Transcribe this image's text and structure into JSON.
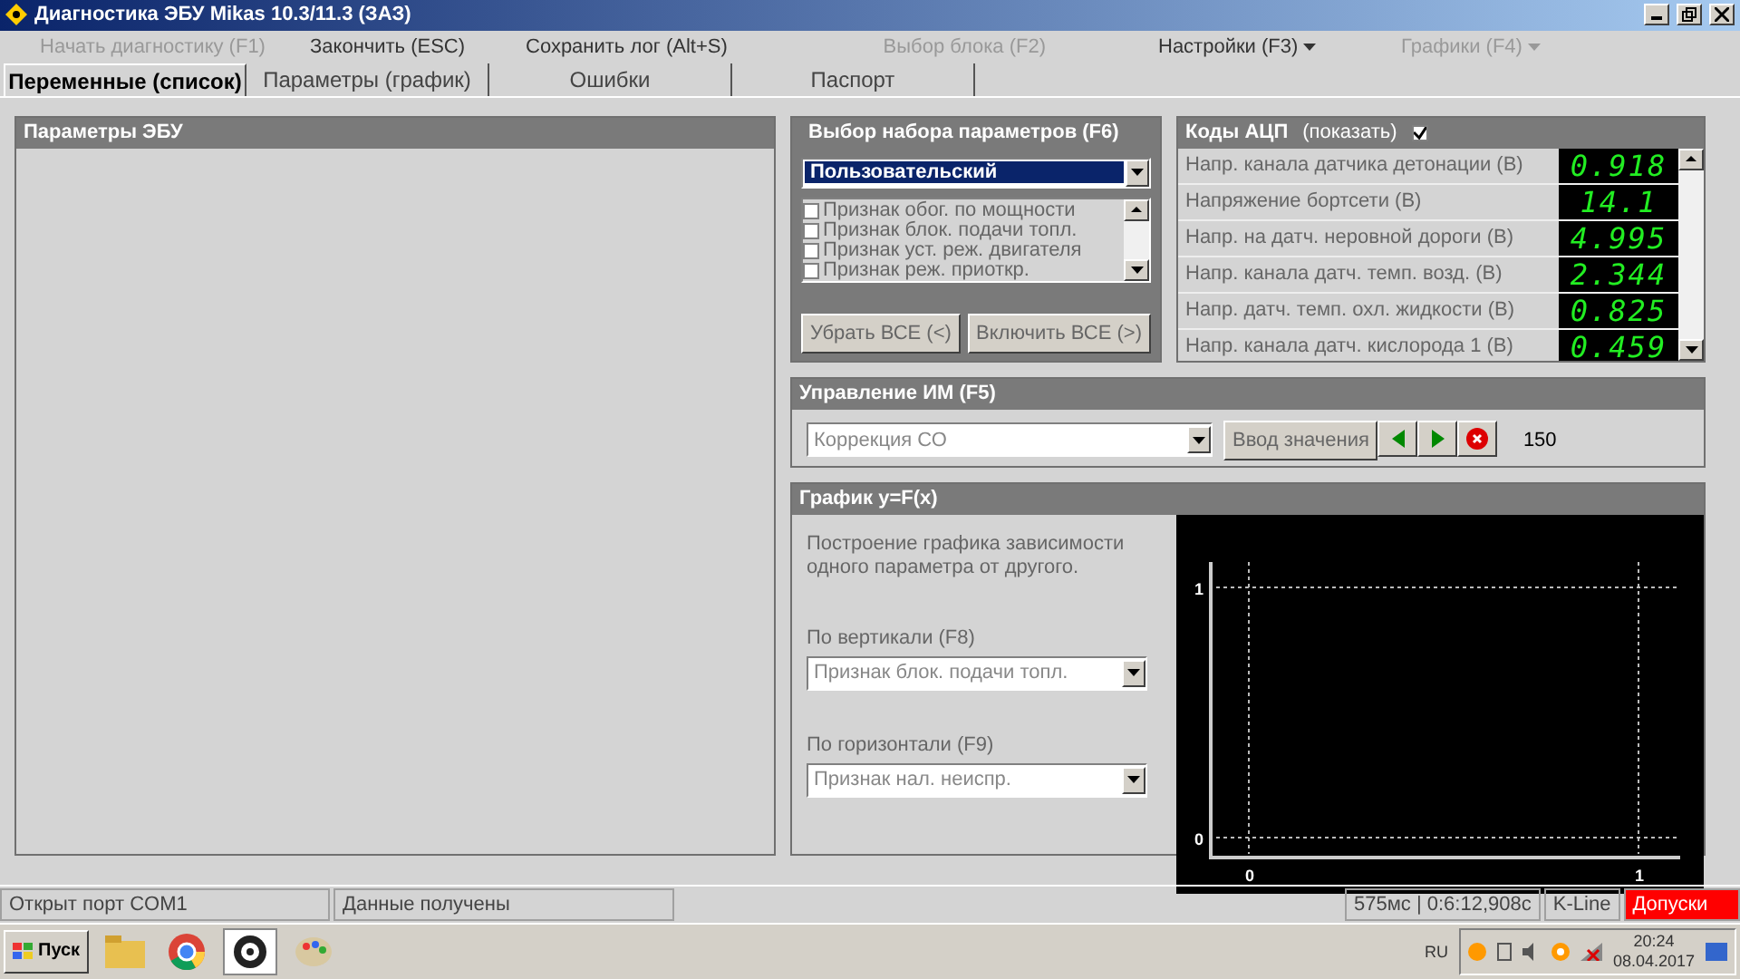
{
  "window": {
    "title": "Диагностика ЭБУ Mikas 10.3/11.3 (ЗАЗ)"
  },
  "menu": [
    {
      "label": "Начать диагностику (F1)",
      "disabled": true,
      "dropdown": false
    },
    {
      "label": "Закончить (ESC)",
      "disabled": false,
      "dropdown": false
    },
    {
      "label": "Сохранить лог (Alt+S)",
      "disabled": false,
      "dropdown": false
    },
    {
      "label": "Выбор блока (F2)",
      "disabled": true,
      "dropdown": false
    },
    {
      "label": "Настройки (F3)",
      "disabled": false,
      "dropdown": true
    },
    {
      "label": "Графики (F4)",
      "disabled": true,
      "dropdown": true
    }
  ],
  "tabs": [
    {
      "label": "Переменные (список)",
      "selected": true
    },
    {
      "label": "Параметры (график)",
      "selected": false
    },
    {
      "label": "Ошибки",
      "selected": false
    },
    {
      "label": "Паспорт",
      "selected": false
    }
  ],
  "ecu_panel": {
    "title": "Параметры ЭБУ"
  },
  "param_set": {
    "title": "Выбор набора параметров (F6)",
    "value": "Пользовательский",
    "items": [
      {
        "label": "Признак обог. по мощности",
        "checked": false
      },
      {
        "label": "Признак блок. подачи топл.",
        "checked": false
      },
      {
        "label": "Признак уст. реж. двигателя",
        "checked": false
      },
      {
        "label": "Признак реж. приоткр.",
        "checked": false
      }
    ],
    "buttons": [
      "Убрать ВСЕ (<)",
      "Включить ВСЕ (>)"
    ]
  },
  "adc": {
    "title": "Коды АЦП",
    "show_label": "(показать)",
    "show_checked": true,
    "rows": [
      {
        "name": "Напр. канала датчика детонации (В)",
        "value": "0.918"
      },
      {
        "name": "Напряжение бортсети (В)",
        "value": "14.1"
      },
      {
        "name": "Напр. на датч. неровной дороги (В)",
        "value": "4.995"
      },
      {
        "name": "Напр. канала датч. темп. возд. (В)",
        "value": "2.344"
      },
      {
        "name": "Напр. датч. темп. охл. жидкости (В)",
        "value": "0.825"
      },
      {
        "name": "Напр. канала датч. кислорода 1 (В)",
        "value": "0.459"
      }
    ]
  },
  "control": {
    "title": "Управление ИМ (F5)",
    "value": "Коррекция СО",
    "button": "Ввод значения",
    "reading": "150"
  },
  "graph": {
    "title": "График y=F(x)",
    "description": "Построение графика зависимости одного параметра от другого.",
    "vertical_label": "По вертикали (F8)",
    "vertical_value": "Признак блок. подачи топл.",
    "horizontal_label": "По горизонтали (F9)",
    "horizontal_value": "Признак нал. неиспр.",
    "chart_data": {
      "type": "line",
      "xlim": [
        0,
        1
      ],
      "ylim": [
        0,
        1
      ],
      "xticks": [
        0,
        1
      ],
      "yticks": [
        0,
        1
      ]
    }
  },
  "status_bar": [
    {
      "text": "Открыт порт COM1",
      "kind": "normal"
    },
    {
      "text": "Данные получены",
      "kind": "normal"
    },
    {
      "text": "575мс | 0:6:12,908с",
      "kind": "normal"
    },
    {
      "text": "K-Line",
      "kind": "normal"
    },
    {
      "text": "Допуски",
      "kind": "alert"
    }
  ],
  "taskbar": {
    "start": "Пуск",
    "language": "RU",
    "time": "20:24",
    "date": "08.04.2017"
  }
}
